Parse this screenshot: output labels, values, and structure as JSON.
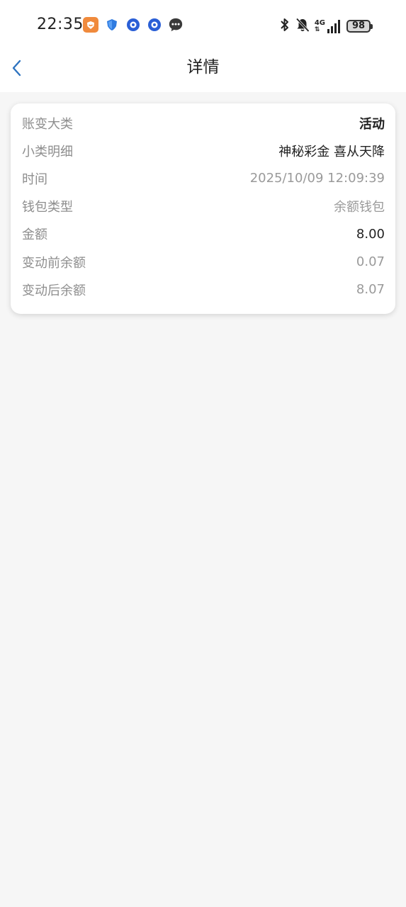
{
  "status_bar": {
    "time": "22:35",
    "network": "4G",
    "battery": "98",
    "left_icons": [
      "app-orange-icon",
      "shield-icon",
      "blue-circle-app-icon",
      "blue-circle-app-icon",
      "message-bubble-icon"
    ],
    "right_icons": [
      "bluetooth-icon",
      "bell-muted-icon",
      "signal-icon",
      "battery-icon"
    ]
  },
  "nav": {
    "title": "详情",
    "back_icon": "chevron-left-icon"
  },
  "details": [
    {
      "label": "账变大类",
      "value": "活动"
    },
    {
      "label": "小类明细",
      "value": "神秘彩金 喜从天降"
    },
    {
      "label": "时间",
      "value": "2025/10/09 12:09:39"
    },
    {
      "label": "钱包类型",
      "value": "余额钱包"
    },
    {
      "label": "金额",
      "value": "8.00"
    },
    {
      "label": "变动前余额",
      "value": "0.07"
    },
    {
      "label": "变动后余额",
      "value": "8.07"
    }
  ],
  "colors": {
    "accent": "#2f74c0",
    "background": "#f6f6f6",
    "card": "#ffffff",
    "label": "#8e8e8e"
  }
}
